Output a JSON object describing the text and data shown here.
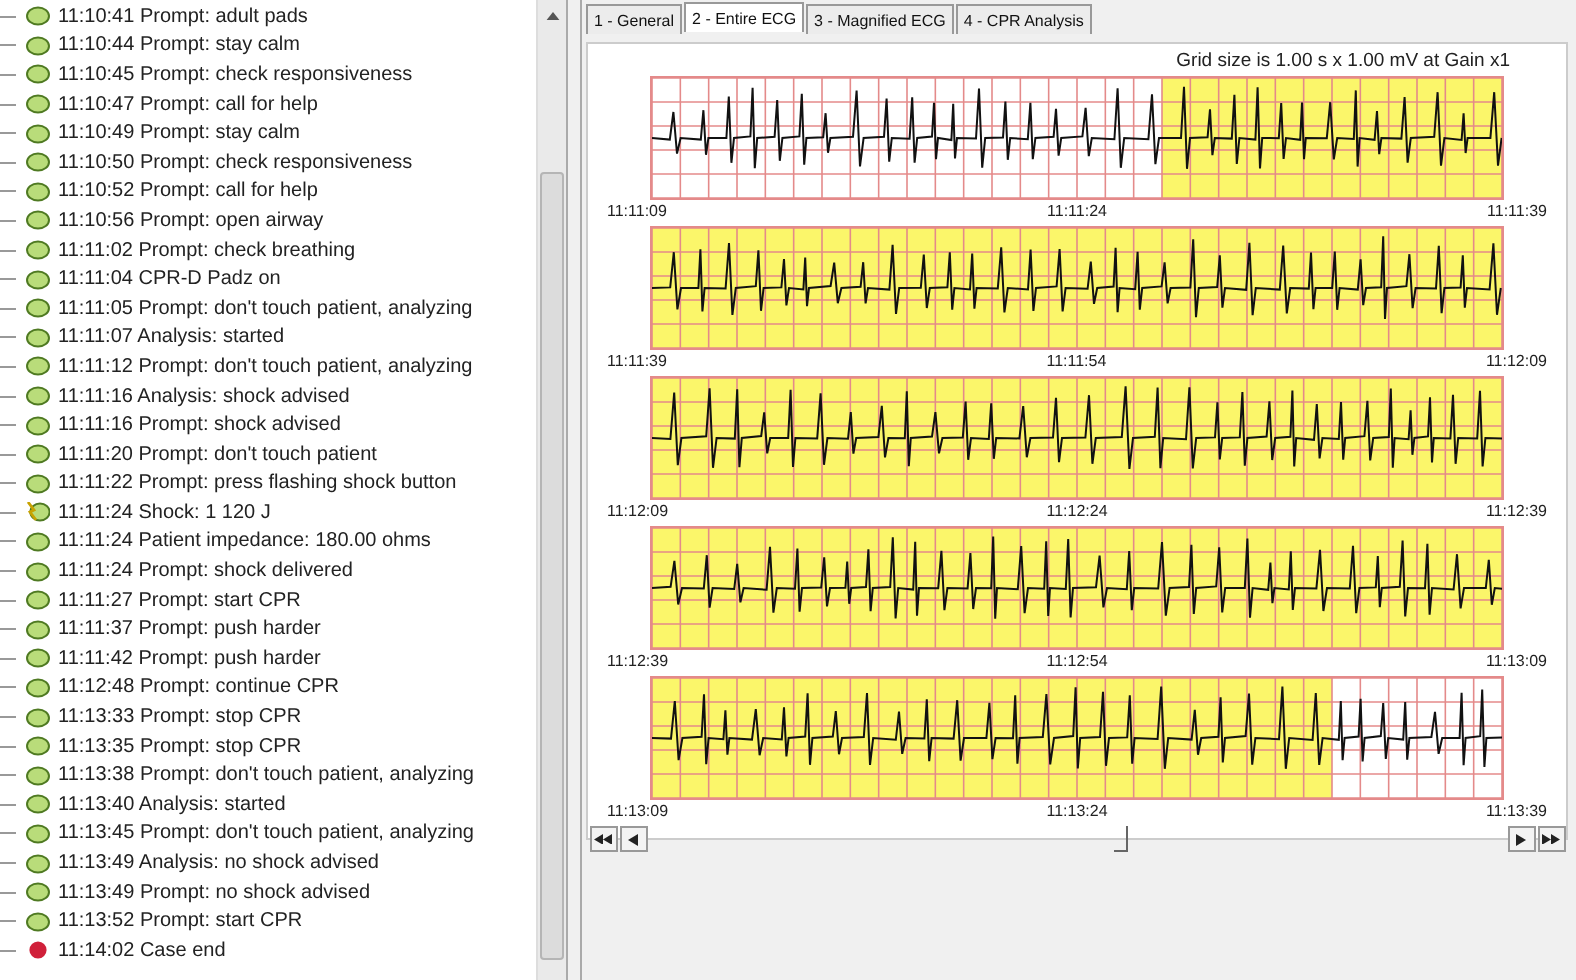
{
  "events": [
    {
      "kind": "prompt",
      "text": "11:10:41 Prompt: adult pads"
    },
    {
      "kind": "prompt",
      "text": "11:10:44 Prompt: stay calm"
    },
    {
      "kind": "prompt",
      "text": "11:10:45 Prompt: check responsiveness"
    },
    {
      "kind": "prompt",
      "text": "11:10:47 Prompt: call for help"
    },
    {
      "kind": "prompt",
      "text": "11:10:49 Prompt: stay calm"
    },
    {
      "kind": "prompt",
      "text": "11:10:50 Prompt: check responsiveness"
    },
    {
      "kind": "prompt",
      "text": "11:10:52 Prompt: call for help"
    },
    {
      "kind": "prompt",
      "text": "11:10:56 Prompt: open airway"
    },
    {
      "kind": "prompt",
      "text": "11:11:02 Prompt: check breathing"
    },
    {
      "kind": "prompt",
      "text": "11:11:04 CPR-D Padz on"
    },
    {
      "kind": "prompt",
      "text": "11:11:05 Prompt: don't touch patient, analyzing"
    },
    {
      "kind": "prompt",
      "text": "11:11:07 Analysis: started"
    },
    {
      "kind": "prompt",
      "text": "11:11:12 Prompt: don't touch patient, analyzing"
    },
    {
      "kind": "prompt",
      "text": "11:11:16 Analysis: shock advised"
    },
    {
      "kind": "prompt",
      "text": "11:11:16 Prompt: shock advised"
    },
    {
      "kind": "prompt",
      "text": "11:11:20 Prompt: don't touch patient"
    },
    {
      "kind": "prompt",
      "text": "11:11:22 Prompt: press flashing shock button"
    },
    {
      "kind": "shock",
      "text": "11:11:24 Shock: 1 120 J"
    },
    {
      "kind": "prompt",
      "text": "11:11:24 Patient impedance: 180.00 ohms"
    },
    {
      "kind": "prompt",
      "text": "11:11:24 Prompt: shock delivered"
    },
    {
      "kind": "prompt",
      "text": "11:11:27 Prompt: start CPR"
    },
    {
      "kind": "prompt",
      "text": "11:11:37 Prompt: push harder"
    },
    {
      "kind": "prompt",
      "text": "11:11:42 Prompt: push harder"
    },
    {
      "kind": "prompt",
      "text": "11:12:48 Prompt: continue CPR"
    },
    {
      "kind": "prompt",
      "text": "11:13:33 Prompt: stop CPR"
    },
    {
      "kind": "prompt",
      "text": "11:13:35 Prompt: stop CPR"
    },
    {
      "kind": "prompt",
      "text": "11:13:38 Prompt: don't touch patient, analyzing"
    },
    {
      "kind": "prompt",
      "text": "11:13:40 Analysis: started"
    },
    {
      "kind": "prompt",
      "text": "11:13:45 Prompt: don't touch patient, analyzing"
    },
    {
      "kind": "prompt",
      "text": "11:13:49 Analysis: no shock advised"
    },
    {
      "kind": "prompt",
      "text": "11:13:49 Prompt: no shock advised"
    },
    {
      "kind": "prompt",
      "text": "11:13:52 Prompt: start CPR"
    },
    {
      "kind": "end",
      "text": "11:14:02 Case end"
    }
  ],
  "tabs": [
    {
      "label": "1 - General",
      "selected": false
    },
    {
      "label": "2 - Entire ECG",
      "selected": true
    },
    {
      "label": "3 - Magnified ECG",
      "selected": false
    },
    {
      "label": "4 - CPR Analysis",
      "selected": false
    }
  ],
  "grid_caption": "Grid size is 1.00 s x 1.00 mV at Gain x1",
  "strips": [
    {
      "highlight_at_end": true,
      "level": 0.4,
      "times": [
        "11:11:09",
        "11:11:24",
        "11:11:39"
      ]
    },
    {
      "level": 1,
      "times": [
        "11:11:39",
        "11:11:54",
        "11:12:09"
      ]
    },
    {
      "level": 1,
      "times": [
        "11:12:09",
        "11:12:24",
        "11:12:39"
      ]
    },
    {
      "level": 1,
      "times": [
        "11:12:39",
        "11:12:54",
        "11:13:09"
      ]
    },
    {
      "highlight_at_end": false,
      "level": 0.8,
      "times": [
        "11:13:09",
        "11:13:24",
        "11:13:39"
      ]
    }
  ]
}
